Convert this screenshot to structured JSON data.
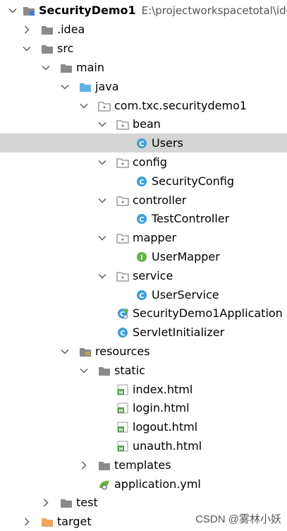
{
  "project": {
    "name": "SecurityDemo1",
    "path": "E:\\projectworkspacetotal\\ide"
  },
  "nodes": {
    "idea": ".idea",
    "src": "src",
    "main": "main",
    "java": "java",
    "package": "com.txc.securitydemo1",
    "bean": "bean",
    "users": "Users",
    "config": "config",
    "security_config": "SecurityConfig",
    "controller": "controller",
    "test_controller": "TestController",
    "mapper": "mapper",
    "user_mapper": "UserMapper",
    "service": "service",
    "user_service": "UserService",
    "application": "SecurityDemo1Application",
    "servlet_initializer": "ServletInitializer",
    "resources": "resources",
    "static": "static",
    "index_html": "index.html",
    "login_html": "login.html",
    "logout_html": "logout.html",
    "unauth_html": "unauth.html",
    "templates": "templates",
    "application_yml": "application.yml",
    "test": "test",
    "target": "target"
  },
  "watermark": "CSDN @雾林小妖",
  "colors": {
    "folder": "#8a8a8a",
    "source_folder": "#5fb2e8",
    "excluded_folder": "#f0a45a",
    "class_icon": "#3d9fd6",
    "interface_icon": "#62b543",
    "html_icon": "#4f9b4a",
    "selected_row": "#d5d5d5"
  }
}
